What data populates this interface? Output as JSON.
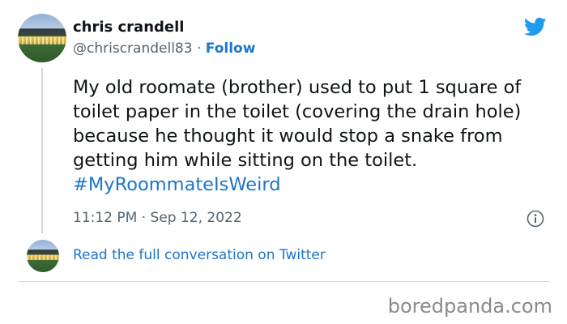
{
  "tweet": {
    "author_name": "chris crandell",
    "author_handle": "@chriscrandell83",
    "separator": " · ",
    "follow_label": "Follow",
    "text": "My old roomate (brother) used to put 1 square of toilet paper in the toilet (covering the drain hole) because he thought it would stop a snake from getting him while sitting on the toilet. ",
    "hashtag": "#MyRoommateIsWeird",
    "time": "11:12 PM · Sep 12, 2022",
    "read_more": "Read the full conversation on Twitter"
  },
  "icons": {
    "brand": "twitter-bird-icon",
    "info": "info-icon"
  },
  "colors": {
    "link": "#1d75c8",
    "twitter_blue": "#1d9bf0",
    "muted": "#536471"
  },
  "watermark": "boredpanda.com"
}
